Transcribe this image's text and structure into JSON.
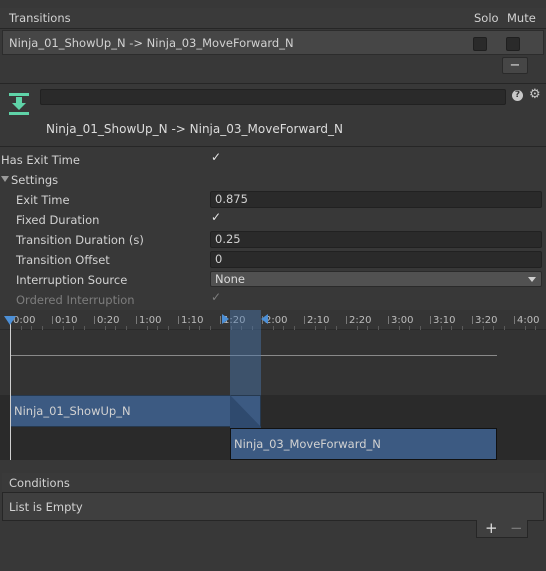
{
  "transitions": {
    "header": "Transitions",
    "solo_label": "Solo",
    "mute_label": "Mute",
    "row_label": "Ninja_01_ShowUp_N -> Ninja_03_MoveForward_N",
    "remove_label": "−"
  },
  "inspector": {
    "title": "Ninja_01_ShowUp_N -> Ninja_03_MoveForward_N",
    "name_value": "",
    "help_icon_glyph": "?",
    "gear_icon_glyph": "⚙"
  },
  "settings": {
    "has_exit_time_label": "Has Exit Time",
    "settings_label": "Settings",
    "exit_time_label": "Exit Time",
    "exit_time_value": "0.875",
    "fixed_duration_label": "Fixed Duration",
    "transition_duration_label": "Transition Duration (s)",
    "transition_duration_value": "0.25",
    "transition_offset_label": "Transition Offset",
    "transition_offset_value": "0",
    "interruption_source_label": "Interruption Source",
    "interruption_source_value": "None",
    "ordered_interruption_label": "Ordered Interruption",
    "check_glyph": "✓"
  },
  "timeline": {
    "ticks": [
      "0:00",
      "0:10",
      "0:20",
      "1:00",
      "1:10",
      "1:20",
      "2:00",
      "2:10",
      "2:20",
      "3:00",
      "3:10",
      "3:20",
      "4:00"
    ],
    "clip_a": "Ninja_01_ShowUp_N",
    "clip_b": "Ninja_03_MoveForward_N"
  },
  "conditions": {
    "header": "Conditions",
    "empty_text": "List is Empty",
    "add_label": "+",
    "remove_label": "−"
  },
  "colors": {
    "clip_blue": "#3c5a82",
    "transition_band": "#4a78b0",
    "accent": "#4c8fd6",
    "download_icon": "#5fd3a8"
  }
}
